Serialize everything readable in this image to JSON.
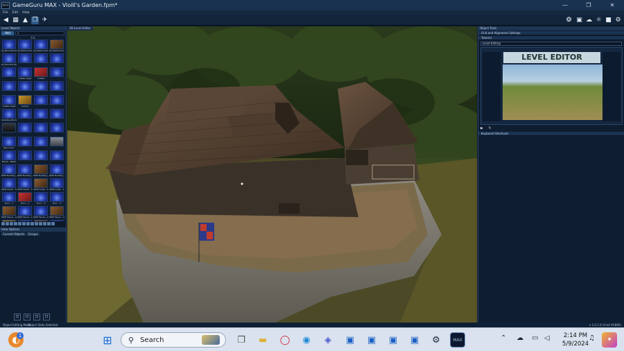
{
  "window": {
    "title": "GameGuru MAX - Vioill's Garden.fpm*",
    "min_glyph": "—",
    "max_glyph": "❐",
    "close_glyph": "✕"
  },
  "menu": [
    "File",
    "Edit",
    "Help"
  ],
  "left_panel": {
    "title": "Level Objects",
    "add_label": "Add",
    "folder_label": "1/1",
    "assets": [
      "All_Blue Barrel",
      "All_Metal Door Closed",
      "All_Metal Door Open",
      "All_Metal Door Bl",
      "All_Window Glass",
      "",
      "",
      "",
      "",
      "Cobble Spall",
      "Cobble",
      "",
      "",
      "",
      "",
      "",
      "Cobble Spall",
      "Carpet",
      "",
      "",
      "Cladding Block",
      "",
      "",
      "",
      "",
      "",
      "",
      "",
      "Barn Door",
      "",
      "",
      "",
      "Barrel - Metal",
      "",
      "",
      "",
      "WHP Building - 0",
      "WHP Building - 0",
      "WHP Building - 1",
      "WHP Building - 1",
      "WHP Chest - 0",
      "WHP Chest - 1",
      "WHP Crate - 0",
      "WHP Crate - 1",
      "Door - 1",
      "Door - 2",
      "Door - 3",
      "Door - 4",
      "WHP Fence - 0",
      "WHP Fence - 1",
      "WHP Fence - 2",
      "WHP Fence - 3",
      "WHP Fence Gate - 0",
      "WHP Fence Gate - 1",
      "WHP Fence Gate - 2",
      "WHP Fence Gate - 3",
      "WHP Stairs - 0",
      "WHP Stairs - 1",
      "WHP Stairs - 2",
      "WHP Stairs - 3",
      "WHP Roof - 0",
      "WHP Roof - 1",
      "WHP Roof - 2",
      "WHP Roof - 3",
      "Invisible Wall",
      "WHP Wall - 0",
      "WHP Wall - 1",
      "WHP Wall - 2",
      "Game Elements",
      "",
      "",
      ""
    ],
    "view_options_title": "View Options",
    "tabs": [
      "Current Objects",
      "Groups"
    ]
  },
  "viewport": {
    "tab_label": "3D Level Editor"
  },
  "right_panel": {
    "title": "Object Tools",
    "sections": [
      "Grid and Alignment Settings",
      "Tutorial"
    ],
    "tutorial_select": "Level Editing",
    "tutorial_banner": "LEVEL EDITOR",
    "keyboard_shortcuts": "Keyboard Shortcuts"
  },
  "status": {
    "left": "Object Editing Mode",
    "mid": "Object Stats Selected",
    "version": "v 1.0.1.0 (Cmd #1892)"
  },
  "taskbar": {
    "search_placeholder": "Search",
    "clock_time": "2:14 PM",
    "clock_date": "5/9/2024",
    "notification_badge": "1"
  }
}
